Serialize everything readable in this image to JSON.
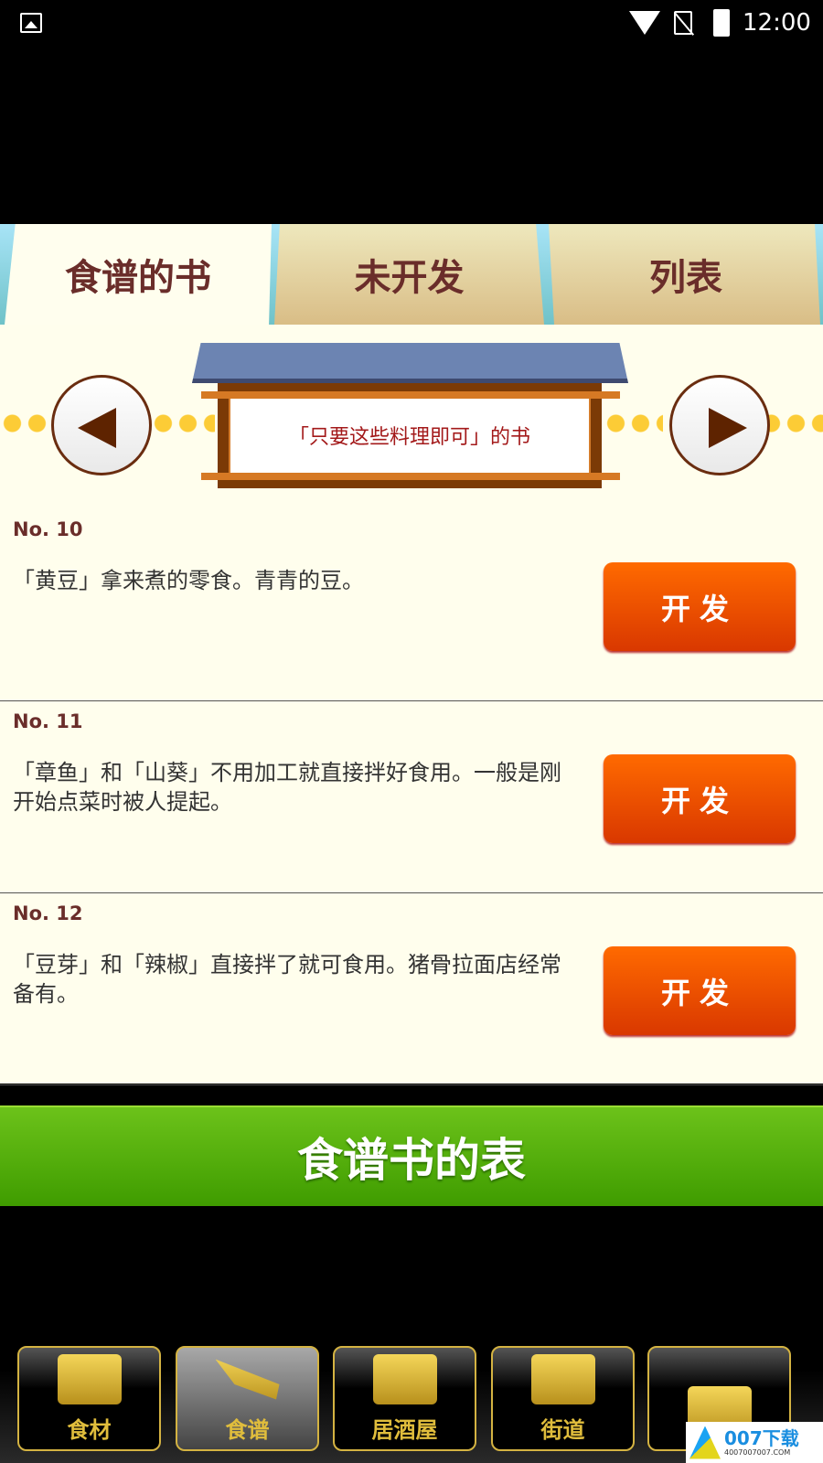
{
  "status_bar": {
    "time": "12:00",
    "icons": [
      "image-icon",
      "wifi-icon",
      "no-sim-icon",
      "battery-charging-icon"
    ]
  },
  "tabs": [
    {
      "label": "食谱的书",
      "active": true
    },
    {
      "label": "未开发",
      "active": false
    },
    {
      "label": "列表",
      "active": false
    }
  ],
  "book": {
    "title": "「只要这些料理即可」的书"
  },
  "items": [
    {
      "no": "No. 10",
      "desc": "「黄豆」拿来煮的零食。青青的豆。",
      "button": "开发"
    },
    {
      "no": "No. 11",
      "desc": "「章鱼」和「山葵」不用加工就直接拌好食用。一般是刚开始点菜时被人提起。",
      "button": "开发"
    },
    {
      "no": "No. 12",
      "desc": "「豆芽」和「辣椒」直接拌了就可食用。猪骨拉面店经常备有。",
      "button": "开发"
    }
  ],
  "list_button": "食谱书的表",
  "bottom_nav": [
    {
      "label": "食材",
      "icon": "ingredients-icon",
      "active": false
    },
    {
      "label": "食谱",
      "icon": "knife-icon",
      "active": true
    },
    {
      "label": "居酒屋",
      "icon": "izakaya-beer-icon",
      "active": false
    },
    {
      "label": "街道",
      "icon": "buildings-icon",
      "active": false
    },
    {
      "label": "",
      "icon": "book-icon",
      "active": false
    }
  ],
  "watermark": {
    "brand": "007下载",
    "url": "4007007007.COM"
  }
}
